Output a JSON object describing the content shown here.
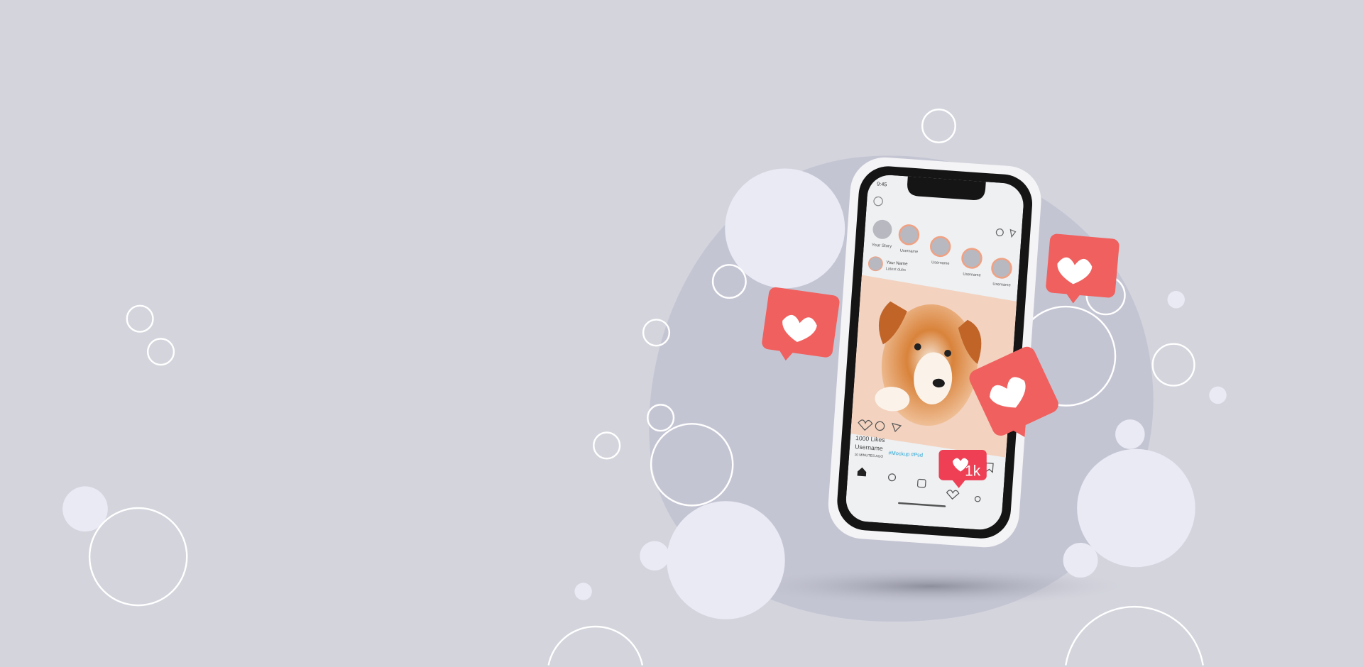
{
  "colors": {
    "background": "#d3d4dc",
    "blob": "#c3c4d2",
    "bubble": "#eaeaf5",
    "heart_badge": "#f0605e",
    "like_badge": "#ee3f55",
    "hashtag": "#2aa7d6"
  },
  "phone": {
    "status_time": "9:45",
    "stories": {
      "your_story": "Your Story",
      "usernames": [
        "Username",
        "Username",
        "Username",
        "Username"
      ]
    },
    "post": {
      "author": "Your Name",
      "subtitle": "Latest dubs",
      "likes": "1000 Likes",
      "username": "Username",
      "hashtags": "#Mockup #Psd",
      "time_ago": "10 MINUTES AGO"
    },
    "like_badge": "1k",
    "nav_icons": [
      "home-icon",
      "search-icon",
      "add-icon",
      "heart-icon",
      "profile-icon"
    ]
  }
}
